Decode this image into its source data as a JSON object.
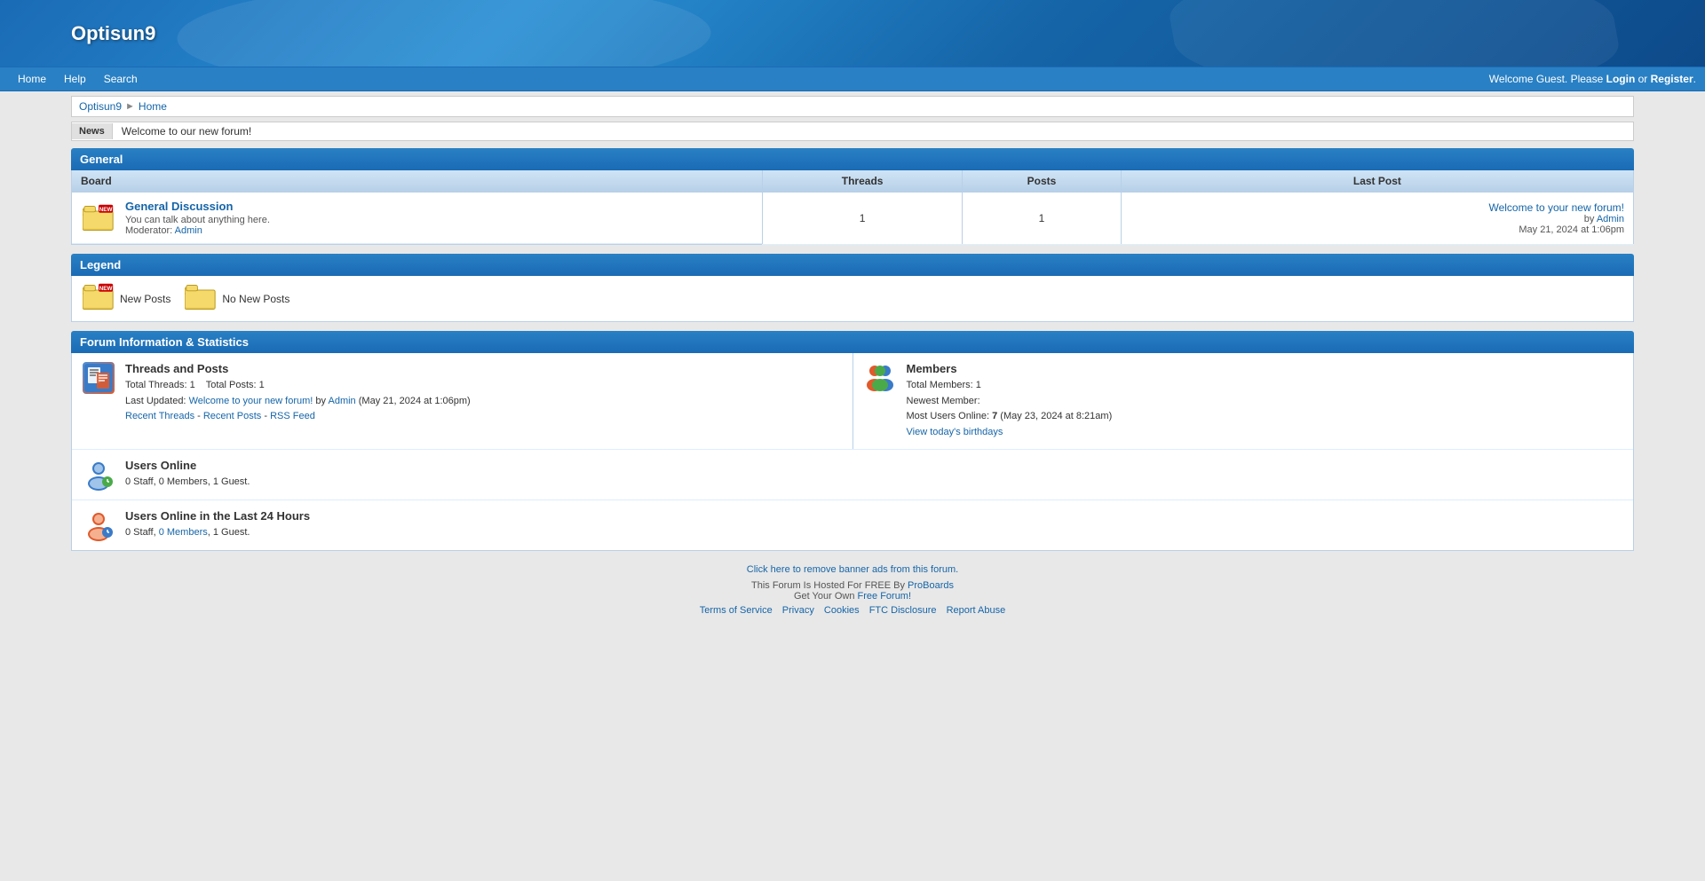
{
  "site": {
    "title": "Optisun9"
  },
  "header": {
    "title": "Optisun9"
  },
  "navbar": {
    "links": [
      {
        "label": "Home",
        "href": "#"
      },
      {
        "label": "Help",
        "href": "#"
      },
      {
        "label": "Search",
        "href": "#"
      }
    ],
    "welcome_prefix": "Welcome Guest. Please ",
    "login_label": "Login",
    "or_text": " or ",
    "register_label": "Register",
    "welcome_suffix": "."
  },
  "breadcrumb": {
    "items": [
      {
        "label": "Optisun9",
        "href": "#"
      },
      {
        "label": "Home",
        "href": "#"
      }
    ]
  },
  "newsbar": {
    "label": "News",
    "content": "Welcome to our new forum!"
  },
  "general_section": {
    "header": "General",
    "table": {
      "columns": {
        "board": "Board",
        "threads": "Threads",
        "posts": "Posts",
        "last_post": "Last Post"
      },
      "rows": [
        {
          "name": "General Discussion",
          "href": "#",
          "description": "You can talk about anything here.",
          "moderator_label": "Moderator:",
          "moderator_name": "Admin",
          "threads": "1",
          "posts": "1",
          "last_post_title": "Welcome to your new forum!",
          "last_post_href": "#",
          "last_post_by": "by",
          "last_post_author": "Admin",
          "last_post_author_href": "#",
          "last_post_date": "May 21, 2024 at 1:06pm"
        }
      ]
    }
  },
  "legend_section": {
    "header": "Legend",
    "items": [
      {
        "label": "New Posts",
        "type": "new"
      },
      {
        "label": "No New Posts",
        "type": "nonew"
      }
    ]
  },
  "forum_info_section": {
    "header": "Forum Information & Statistics",
    "threads_and_posts": {
      "title": "Threads and Posts",
      "total_threads_label": "Total Threads:",
      "total_threads": "1",
      "total_posts_label": "Total Posts:",
      "total_posts": "1",
      "last_updated_label": "Last Updated:",
      "last_updated_post": "Welcome to your new forum!",
      "last_updated_post_href": "#",
      "last_updated_by": "by",
      "last_updated_author": "Admin",
      "last_updated_author_href": "#",
      "last_updated_date": "(May 21, 2024 at 1:06pm)",
      "recent_threads_label": "Recent Threads",
      "recent_threads_href": "#",
      "separator1": " - ",
      "recent_posts_label": "Recent Posts",
      "recent_posts_href": "#",
      "separator2": " - ",
      "rss_feed_label": "RSS Feed",
      "rss_feed_href": "#"
    },
    "members": {
      "title": "Members",
      "total_members_label": "Total Members:",
      "total_members": "1",
      "newest_member_label": "Newest Member:",
      "newest_member": "",
      "most_users_label": "Most Users Online:",
      "most_users": "7",
      "most_users_date": "(May 23, 2024 at 8:21am)",
      "view_birthdays_label": "View today's birthdays",
      "view_birthdays_href": "#"
    },
    "users_online": {
      "title": "Users Online",
      "detail": "0 Staff, 0 Members, 1 Guest."
    },
    "users_online_24h": {
      "title": "Users Online in the Last 24 Hours",
      "prefix": "0 Staff, ",
      "members_label": "0 Members",
      "members_href": "#",
      "suffix": ", 1 Guest."
    }
  },
  "footer": {
    "remove_banner_text": "Click here to remove banner ads from this forum.",
    "remove_banner_href": "#",
    "hosted_prefix": "This Forum Is Hosted For FREE By ",
    "proboards_label": "ProBoards",
    "proboards_href": "#",
    "get_forum_prefix": "Get Your Own ",
    "free_forum_label": "Free Forum!",
    "free_forum_href": "#",
    "links": [
      {
        "label": "Terms of Service",
        "href": "#"
      },
      {
        "label": "Privacy",
        "href": "#"
      },
      {
        "label": "Cookies",
        "href": "#"
      },
      {
        "label": "FTC Disclosure",
        "href": "#"
      },
      {
        "label": "Report Abuse",
        "href": "#"
      }
    ]
  }
}
